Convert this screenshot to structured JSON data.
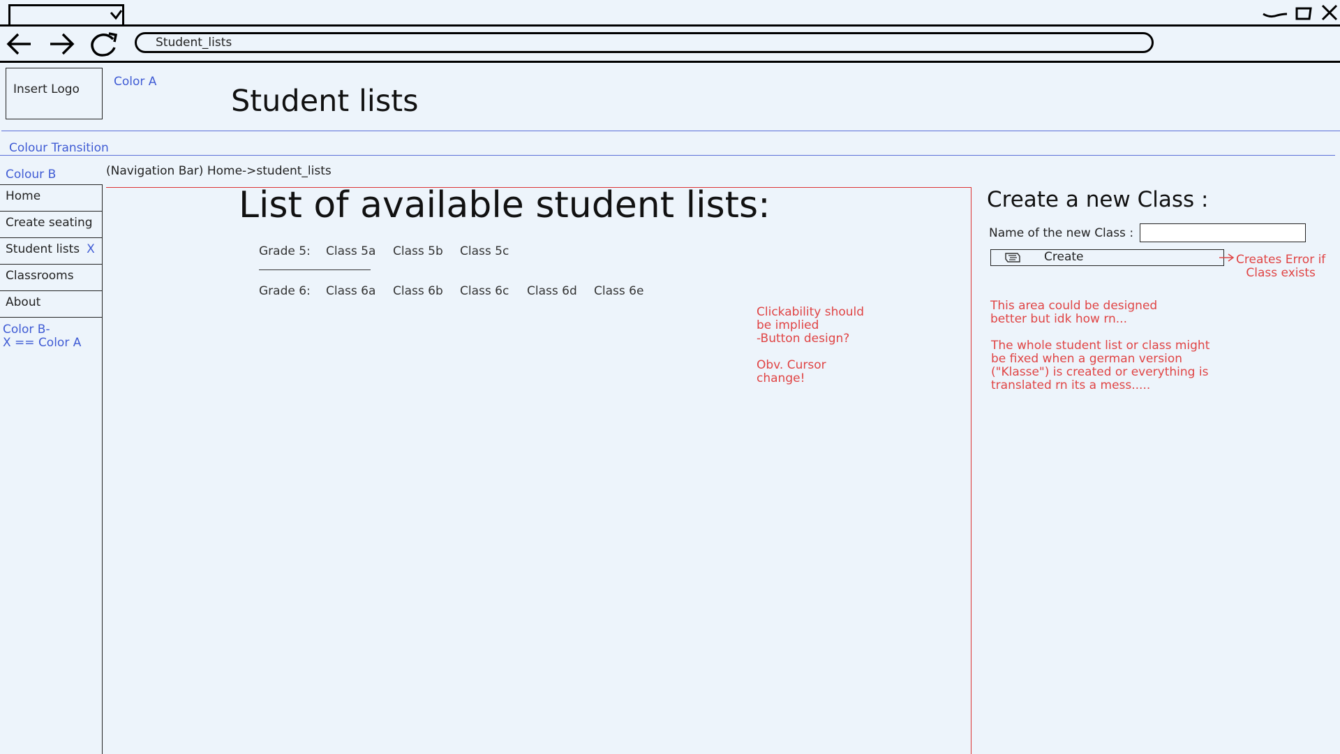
{
  "browser": {
    "address": "Student_lists"
  },
  "header": {
    "logo_placeholder": "Insert Logo",
    "color_a_note": "Color A",
    "title": "Student lists",
    "colour_transition_note": "Colour Transition",
    "colour_b_note": "Colour B",
    "breadcrumb": "(Navigation Bar) Home->student_lists"
  },
  "sidebar": {
    "items": [
      {
        "label": "Home"
      },
      {
        "label": "Create seating"
      },
      {
        "label": "Student lists",
        "marker": "X"
      },
      {
        "label": "Classrooms"
      },
      {
        "label": "About"
      }
    ],
    "note_line1": "Color B-",
    "note_line2": "X == Color A"
  },
  "main": {
    "title": "List of available student lists:",
    "grades": [
      {
        "label": "Grade 5:",
        "classes": [
          "Class 5a",
          "Class 5b",
          "Class 5c"
        ]
      },
      {
        "label": "Grade 6:",
        "classes": [
          "Class 6a",
          "Class 6b",
          "Class 6c",
          "Class 6d",
          "Class 6e"
        ]
      }
    ],
    "annotation": {
      "line1": "Clickability should",
      "line2": "be implied",
      "line3": "-Button design?",
      "line4": "Obv. Cursor",
      "line5": "change!"
    }
  },
  "create_panel": {
    "title": "Create a new Class :",
    "name_label": "Name of the new Class :",
    "name_value": "",
    "button_label": "Create",
    "error_note_line1": "Creates Error if",
    "error_note_line2": "Class exists",
    "note1_line1": "This area could be designed",
    "note1_line2": "better but idk how rn...",
    "note2_line1": "The whole student list or class might",
    "note2_line2": "be fixed when a german version",
    "note2_line3": "(\"Klasse\") is created or everything is",
    "note2_line4": "translated rn its a mess....."
  },
  "colors": {
    "background": "#edf4fb",
    "annotation_blue": "#3f5bd4",
    "annotation_red": "#e04444"
  },
  "icons": [
    "back-arrow-icon",
    "forward-arrow-icon",
    "reload-icon",
    "minimize-icon",
    "maximize-icon",
    "close-icon",
    "create-icon"
  ]
}
